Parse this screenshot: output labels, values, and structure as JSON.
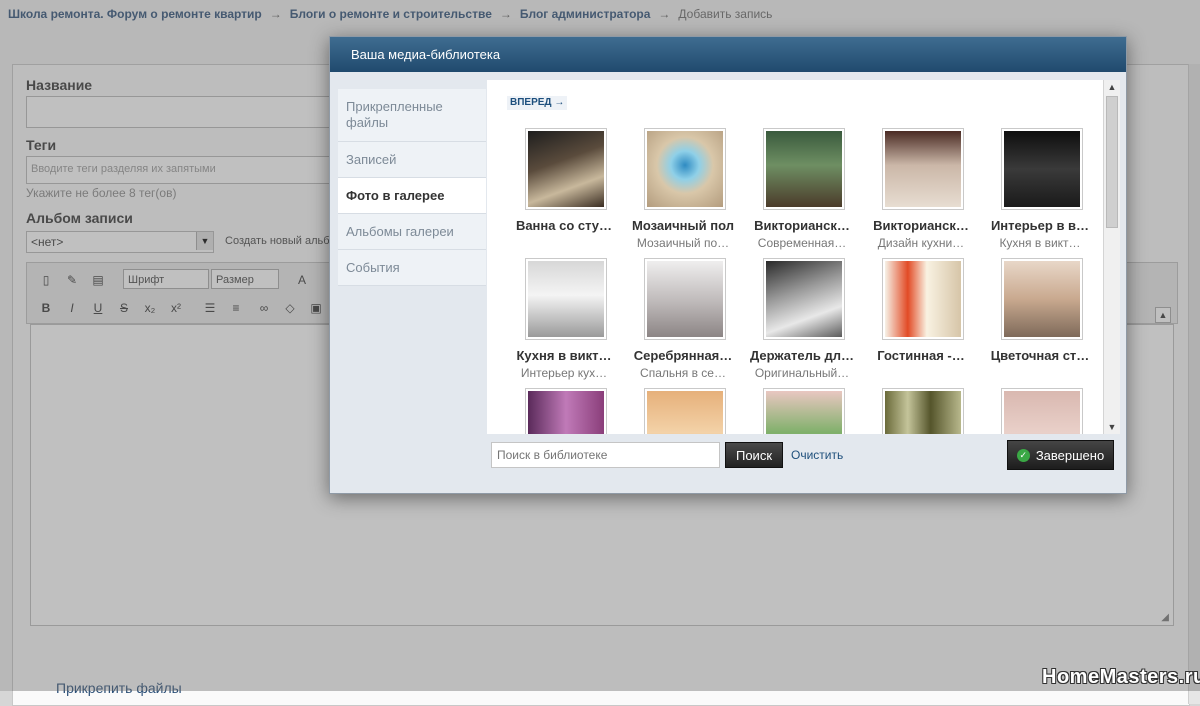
{
  "breadcrumb": {
    "items": [
      "Школа ремонта. Форум о ремонте квартир",
      "Блоги о ремонте и строительстве",
      "Блог администратора"
    ],
    "current": "Добавить запись",
    "sep": "→"
  },
  "form": {
    "title_label": "Название",
    "tags_label": "Теги",
    "tags_placeholder": "Вводите теги разделяя их запятыми",
    "tags_hint": "Укажите не более 8 тег(ов)",
    "album_label": "Альбом записи",
    "album_value": "<нет>",
    "album_create": "Создать новый альбом",
    "font_select": "Шрифт",
    "size_select": "Размер",
    "attach_link": "Прикрепить файлы"
  },
  "modal": {
    "title": "Ваша медиа-библиотека",
    "tabs": [
      {
        "label": "Прикрепленные файлы",
        "active": false
      },
      {
        "label": "Записей",
        "active": false
      },
      {
        "label": "Фото в галерее",
        "active": true
      },
      {
        "label": "Альбомы галереи",
        "active": false
      },
      {
        "label": "События",
        "active": false
      }
    ],
    "next_label": "ВПЕРЕД →",
    "tiles": [
      {
        "title": "Ванна со сту…",
        "subtitle": ""
      },
      {
        "title": "Мозаичный пол",
        "subtitle": "Мозаичный по…"
      },
      {
        "title": "Викторианск…",
        "subtitle": "Современная…"
      },
      {
        "title": "Викторианск…",
        "subtitle": "Дизайн кухни…"
      },
      {
        "title": "Интерьер в в…",
        "subtitle": "Кухня в викт…"
      },
      {
        "title": "Кухня в викт…",
        "subtitle": "Интерьер кух…"
      },
      {
        "title": "Серебрянная…",
        "subtitle": "Спальня в се…"
      },
      {
        "title": "Держатель дл…",
        "subtitle": "Оригинальный…"
      },
      {
        "title": "Гостинная -…",
        "subtitle": ""
      },
      {
        "title": "Цветочная ст…",
        "subtitle": ""
      },
      {
        "title": "",
        "subtitle": ""
      },
      {
        "title": "",
        "subtitle": ""
      },
      {
        "title": "",
        "subtitle": ""
      },
      {
        "title": "",
        "subtitle": ""
      },
      {
        "title": "",
        "subtitle": ""
      }
    ],
    "search_placeholder": "Поиск в библиотеке",
    "search_button": "Поиск",
    "clear_link": "Очистить",
    "done_button": "Завершено"
  },
  "colors": {
    "header": "#2c587c",
    "link": "#2b4f77",
    "done_check": "#3aa845"
  },
  "watermark": "HomeMasters.ru"
}
